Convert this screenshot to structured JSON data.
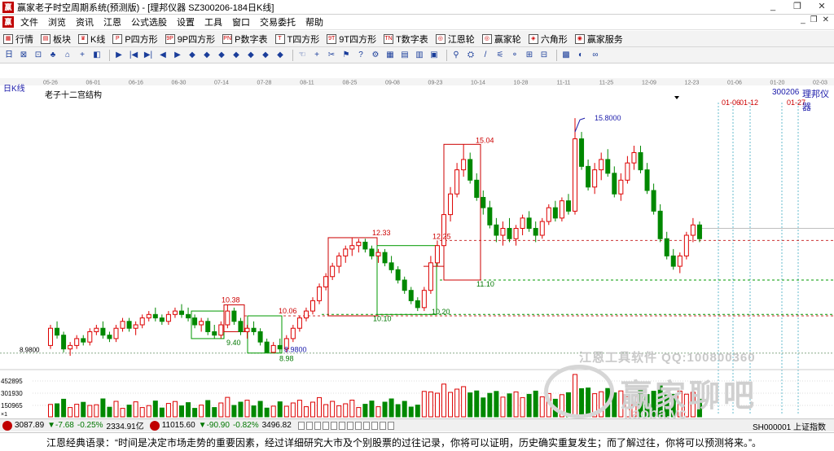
{
  "window": {
    "title": "赢家老子时空周期系统(预测版) - [理邦仪器  SZ300206-184日K线]",
    "app_logo": "赢",
    "controls": [
      "_",
      "❐",
      "✕"
    ]
  },
  "menu": {
    "logo": "赢",
    "items": [
      "文件",
      "浏览",
      "资讯",
      "江恩",
      "公式选股",
      "设置",
      "工具",
      "窗口",
      "交易委托",
      "帮助"
    ],
    "mdi_controls": [
      "_",
      "❐",
      "✕"
    ]
  },
  "toolbar": {
    "buttons": [
      {
        "label": "行情",
        "icon": "grid-icon"
      },
      {
        "label": "板块",
        "icon": "blocks-icon"
      },
      {
        "label": "K线",
        "icon": "candles-icon"
      },
      {
        "label": "P四方形",
        "icon": "p-square-icon"
      },
      {
        "label": "9P四方形",
        "icon": "9p-square-icon"
      },
      {
        "label": "P数字表",
        "icon": "p-table-icon"
      },
      {
        "label": "T四方形",
        "icon": "t-square-icon"
      },
      {
        "label": "9T四方形",
        "icon": "9t-square-icon"
      },
      {
        "label": "T数字表",
        "icon": "t-table-icon"
      },
      {
        "label": "江恩轮",
        "icon": "gann-wheel-icon"
      },
      {
        "label": "赢家轮",
        "icon": "winner-wheel-icon"
      },
      {
        "label": "六角形",
        "icon": "hexagon-icon"
      },
      {
        "label": "赢家服务",
        "icon": "service-icon"
      }
    ]
  },
  "tools": [
    "日",
    "⊠",
    "⊡",
    "♣",
    "⌂",
    "+",
    "◧",
    "▶",
    "|◀",
    "▶|",
    "◀",
    "▶",
    "◆",
    "◆",
    "◆",
    "◆",
    "◆",
    "◆",
    "◆",
    "☜",
    "+",
    "✂",
    "⚑",
    "?",
    "⚙",
    "▦",
    "▤",
    "▥",
    "▣",
    "⚲",
    "⛭",
    "/",
    "⚟",
    "⚬",
    "⊞",
    "⊟",
    "▩",
    "◐",
    "∞"
  ],
  "chart": {
    "period_label": "日K线",
    "structure_label": "老子十二宫结构",
    "stock_code": "300206",
    "stock_name": "理邦仪器",
    "date_ticks": [
      "05-26",
      "06-01",
      "06-16",
      "06-30",
      "07-14",
      "07-28",
      "08-11",
      "08-25",
      "09-08",
      "09-23",
      "10-14",
      "10-28",
      "11-11",
      "11-25",
      "12-09",
      "12-23",
      "01-06",
      "01-20",
      "02-03"
    ],
    "forecast_labels": [
      "01-06",
      "01-12",
      "01-27"
    ],
    "price_labels": [
      {
        "text": "15.8000",
        "color": "#1a1aaa"
      },
      {
        "text": "15.04",
        "color": "#cc0000"
      },
      {
        "text": "12.33",
        "color": "#cc0000"
      },
      {
        "text": "12.25",
        "color": "#cc0000"
      },
      {
        "text": "11.10",
        "color": "#007700"
      },
      {
        "text": "10.38",
        "color": "#cc0000"
      },
      {
        "text": "10.06",
        "color": "#cc0000"
      },
      {
        "text": "10.10",
        "color": "#007700"
      },
      {
        "text": "10.20",
        "color": "#007700"
      },
      {
        "text": "9.40",
        "color": "#007700"
      },
      {
        "text": "8.9800",
        "color": "#1a1aaa"
      },
      {
        "text": "8.98",
        "color": "#007700"
      }
    ],
    "left_axis_price": "8.9800",
    "volume_axis": [
      "452895",
      "301930",
      "150965"
    ],
    "volume_unit": "×1"
  },
  "chart_data": {
    "type": "candlestick",
    "series": [
      {
        "values": [
          [
            9.2,
            9.8,
            9.1,
            9.7
          ],
          [
            9.7,
            9.9,
            9.4,
            9.5
          ],
          [
            9.5,
            9.6,
            9.0,
            9.1
          ],
          [
            9.1,
            9.3,
            8.9,
            9.2
          ],
          [
            9.2,
            9.5,
            9.1,
            9.4
          ],
          [
            9.4,
            9.5,
            9.2,
            9.3
          ],
          [
            9.3,
            9.7,
            9.2,
            9.6
          ],
          [
            9.6,
            9.8,
            9.5,
            9.7
          ],
          [
            9.7,
            9.9,
            9.4,
            9.5
          ],
          [
            9.5,
            9.6,
            9.3,
            9.4
          ],
          [
            9.4,
            9.8,
            9.3,
            9.7
          ],
          [
            9.7,
            10.0,
            9.6,
            9.9
          ],
          [
            9.9,
            10.0,
            9.6,
            9.7
          ],
          [
            9.7,
            9.9,
            9.5,
            9.8
          ],
          [
            9.8,
            10.1,
            9.7,
            10.0
          ],
          [
            10.0,
            10.2,
            9.9,
            10.1
          ],
          [
            10.1,
            10.3,
            9.9,
            10.0
          ],
          [
            10.0,
            10.1,
            9.8,
            9.9
          ],
          [
            9.9,
            10.2,
            9.8,
            10.1
          ],
          [
            10.1,
            10.3,
            10.0,
            10.2
          ],
          [
            10.2,
            10.4,
            10.0,
            10.1
          ],
          [
            10.1,
            10.3,
            9.9,
            10.0
          ],
          [
            10.0,
            10.1,
            9.7,
            9.8
          ],
          [
            9.8,
            10.0,
            9.6,
            9.9
          ],
          [
            9.9,
            10.0,
            9.5,
            9.6
          ],
          [
            9.6,
            9.8,
            9.4,
            9.5
          ],
          [
            9.5,
            9.9,
            9.4,
            9.8
          ],
          [
            9.8,
            10.38,
            9.7,
            10.2
          ],
          [
            10.2,
            10.3,
            9.8,
            9.9
          ],
          [
            9.9,
            10.0,
            9.5,
            9.6
          ],
          [
            9.6,
            9.8,
            9.4,
            9.7
          ],
          [
            9.7,
            9.9,
            9.5,
            9.6
          ],
          [
            9.6,
            9.7,
            9.2,
            9.3
          ],
          [
            9.3,
            9.4,
            8.98,
            9.0
          ],
          [
            9.0,
            9.3,
            8.98,
            9.2
          ],
          [
            9.2,
            9.4,
            9.0,
            9.1
          ],
          [
            9.1,
            9.5,
            9.0,
            9.4
          ],
          [
            9.4,
            9.8,
            9.3,
            9.7
          ],
          [
            9.7,
            10.06,
            9.6,
            10.0
          ],
          [
            10.0,
            10.3,
            9.9,
            10.2
          ],
          [
            10.2,
            10.6,
            10.1,
            10.5
          ],
          [
            10.5,
            11.0,
            10.4,
            10.9
          ],
          [
            10.9,
            11.3,
            10.8,
            11.2
          ],
          [
            11.2,
            11.6,
            11.1,
            11.5
          ],
          [
            11.5,
            11.9,
            11.3,
            11.8
          ],
          [
            11.8,
            12.1,
            11.6,
            12.0
          ],
          [
            12.0,
            12.33,
            11.8,
            12.1
          ],
          [
            12.1,
            12.3,
            11.9,
            12.2
          ],
          [
            12.2,
            12.3,
            11.9,
            12.0
          ],
          [
            12.0,
            12.1,
            11.7,
            11.8
          ],
          [
            11.8,
            12.0,
            11.6,
            11.9
          ],
          [
            11.9,
            12.0,
            11.5,
            11.6
          ],
          [
            11.6,
            11.8,
            11.3,
            11.4
          ],
          [
            11.4,
            11.5,
            11.0,
            11.1
          ],
          [
            11.1,
            11.2,
            10.7,
            10.8
          ],
          [
            10.8,
            10.9,
            10.4,
            10.5
          ],
          [
            10.5,
            10.6,
            10.2,
            10.3
          ],
          [
            10.3,
            10.9,
            10.2,
            10.8
          ],
          [
            10.8,
            11.8,
            10.7,
            11.6
          ],
          [
            11.6,
            12.25,
            11.5,
            12.1
          ],
          [
            12.1,
            13.2,
            12.0,
            13.0
          ],
          [
            13.0,
            13.8,
            12.8,
            13.6
          ],
          [
            13.6,
            14.5,
            13.5,
            14.3
          ],
          [
            14.3,
            15.04,
            14.1,
            14.6
          ],
          [
            14.6,
            14.8,
            13.9,
            14.0
          ],
          [
            14.0,
            14.2,
            13.4,
            13.5
          ],
          [
            13.5,
            13.7,
            13.0,
            13.2
          ],
          [
            13.2,
            13.4,
            12.6,
            12.7
          ],
          [
            12.7,
            12.9,
            12.2,
            12.4
          ],
          [
            12.4,
            12.8,
            12.1,
            12.6
          ],
          [
            12.6,
            12.9,
            12.2,
            12.3
          ],
          [
            12.3,
            12.7,
            12.1,
            12.6
          ],
          [
            12.6,
            13.0,
            12.4,
            12.9
          ],
          [
            12.9,
            13.1,
            12.5,
            12.6
          ],
          [
            12.6,
            12.8,
            12.2,
            12.4
          ],
          [
            12.4,
            12.9,
            12.3,
            12.8
          ],
          [
            12.8,
            13.3,
            12.7,
            13.2
          ],
          [
            13.2,
            13.4,
            12.8,
            12.9
          ],
          [
            12.9,
            13.5,
            12.8,
            13.4
          ],
          [
            13.4,
            13.6,
            13.0,
            13.1
          ],
          [
            13.1,
            15.8,
            13.0,
            15.2
          ],
          [
            15.2,
            15.4,
            14.3,
            14.4
          ],
          [
            14.4,
            14.6,
            13.7,
            13.8
          ],
          [
            13.8,
            14.5,
            13.6,
            14.3
          ],
          [
            14.3,
            14.8,
            14.0,
            14.6
          ],
          [
            14.6,
            14.9,
            14.1,
            14.2
          ],
          [
            14.2,
            14.4,
            13.5,
            13.6
          ],
          [
            13.6,
            14.2,
            13.4,
            14.0
          ],
          [
            14.0,
            14.7,
            13.9,
            14.5
          ],
          [
            14.5,
            15.0,
            14.3,
            14.8
          ],
          [
            14.8,
            15.0,
            14.2,
            14.3
          ],
          [
            14.3,
            14.5,
            13.6,
            13.7
          ],
          [
            13.7,
            13.9,
            13.0,
            13.1
          ],
          [
            13.1,
            13.3,
            12.2,
            12.3
          ],
          [
            12.3,
            12.5,
            11.7,
            11.8
          ],
          [
            11.8,
            12.0,
            11.4,
            11.5
          ],
          [
            11.5,
            11.9,
            11.3,
            11.8
          ],
          [
            11.8,
            12.5,
            11.7,
            12.4
          ],
          [
            12.4,
            12.9,
            12.2,
            12.7
          ],
          [
            12.7,
            12.8,
            12.2,
            12.3
          ]
        ]
      }
    ],
    "ylim": [
      8.5,
      16.3
    ]
  },
  "status": {
    "sh_index": "3087.89",
    "sh_change": "▼-7.68",
    "sh_pct": "-0.25%",
    "sh_amount": "2334.91亿",
    "sz_index": "11015.60",
    "sz_change": "▼-90.90",
    "sz_pct": "-0.82%",
    "sz_amount": "3496.82",
    "right_label": "SH000001 上证指数"
  },
  "quote": "江恩经典语录：“时间是决定市场走势的重要因素，经过详细研究大市及个别股票的过往记录，你将可以证明，历史确实重复发生；而了解过往，你将可以预测将来。”。",
  "watermark": {
    "line1": "江恩工具软件  QQ:100800360",
    "line2": "赢家聊吧",
    "line3": "liaoba.yc"
  }
}
